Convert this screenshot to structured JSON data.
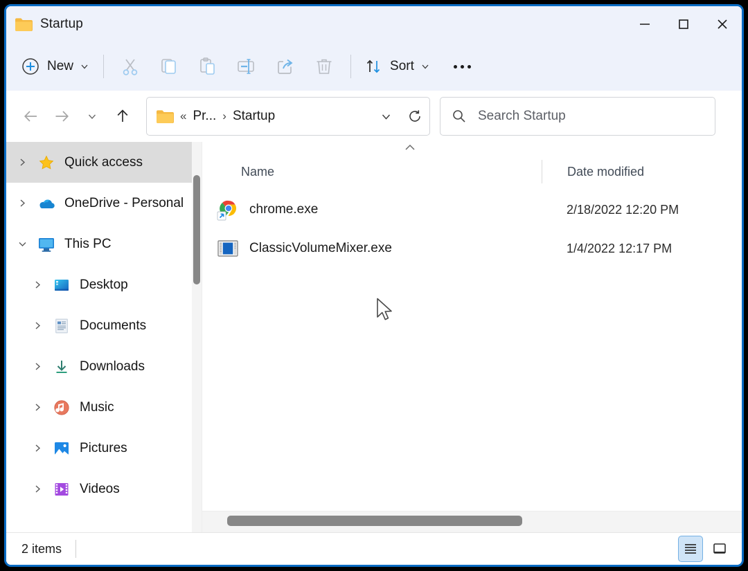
{
  "window": {
    "title": "Startup",
    "title_icon": "folder-icon",
    "controls": {
      "minimize": "minimize-icon",
      "maximize": "maximize-icon",
      "close": "close-icon"
    }
  },
  "toolbar": {
    "new_label": "New",
    "new_icon": "plus-circle-icon",
    "new_chevron": "chevron-down-icon",
    "actions": [
      {
        "name": "cut",
        "icon": "scissors-icon",
        "enabled": false
      },
      {
        "name": "copy",
        "icon": "copy-icon",
        "enabled": false
      },
      {
        "name": "paste",
        "icon": "clipboard-paste-icon",
        "enabled": false
      },
      {
        "name": "rename",
        "icon": "rename-icon",
        "enabled": false
      },
      {
        "name": "share",
        "icon": "share-icon",
        "enabled": false
      },
      {
        "name": "delete",
        "icon": "trash-icon",
        "enabled": false
      }
    ],
    "sort_label": "Sort",
    "sort_icon": "sort-arrows-icon",
    "more_label": "See more",
    "more_icon": "ellipsis-icon"
  },
  "navigation": {
    "back_icon": "arrow-left-icon",
    "forward_icon": "arrow-right-icon",
    "recent_icon": "chevron-down-icon",
    "up_icon": "arrow-up-icon"
  },
  "addressbar": {
    "folder_icon": "folder-icon",
    "overflow": "«",
    "crumbs": [
      {
        "label": "Pr...",
        "separator": "›"
      },
      {
        "label": "Startup",
        "separator": ""
      }
    ],
    "dropdown_icon": "chevron-down-icon",
    "refresh_icon": "refresh-icon"
  },
  "search": {
    "icon": "search-icon",
    "placeholder": "Search Startup",
    "value": ""
  },
  "sidebar": {
    "items": [
      {
        "label": "Quick access",
        "icon": "star-icon",
        "chevron": "chevron-right-icon",
        "selected": true,
        "indent": false
      },
      {
        "label": "OneDrive - Personal",
        "icon": "cloud-icon",
        "chevron": "chevron-right-icon",
        "selected": false,
        "indent": false
      },
      {
        "label": "This PC",
        "icon": "monitor-icon",
        "chevron": "chevron-down-icon",
        "selected": false,
        "indent": false
      },
      {
        "label": "Desktop",
        "icon": "desktop-icon",
        "chevron": "chevron-right-icon",
        "selected": false,
        "indent": true
      },
      {
        "label": "Documents",
        "icon": "documents-icon",
        "chevron": "chevron-right-icon",
        "selected": false,
        "indent": true
      },
      {
        "label": "Downloads",
        "icon": "downloads-icon",
        "chevron": "chevron-right-icon",
        "selected": false,
        "indent": true
      },
      {
        "label": "Music",
        "icon": "music-icon",
        "chevron": "chevron-right-icon",
        "selected": false,
        "indent": true
      },
      {
        "label": "Pictures",
        "icon": "pictures-icon",
        "chevron": "chevron-right-icon",
        "selected": false,
        "indent": true
      },
      {
        "label": "Videos",
        "icon": "videos-icon",
        "chevron": "chevron-right-icon",
        "selected": false,
        "indent": true
      }
    ]
  },
  "filelist": {
    "sort_indicator": "chevron-up-icon",
    "columns": [
      {
        "key": "name",
        "label": "Name"
      },
      {
        "key": "date",
        "label": "Date modified"
      }
    ],
    "rows": [
      {
        "name": "chrome.exe",
        "icon": "chrome-shortcut-icon",
        "date": "2/18/2022 12:20 PM"
      },
      {
        "name": "ClassicVolumeMixer.exe",
        "icon": "app-window-icon",
        "date": "1/4/2022 12:17 PM"
      }
    ]
  },
  "statusbar": {
    "item_count": "2 items",
    "views": [
      {
        "name": "details-view",
        "icon": "details-view-icon",
        "active": true
      },
      {
        "name": "preview-pane",
        "icon": "preview-pane-icon",
        "active": false
      }
    ]
  },
  "colors": {
    "accent": "#0a6cc4",
    "chrome_bg": "#eef2fb",
    "selection": "#dcdcdc",
    "disabled_icon": "#b4b8bf",
    "blue_accent": "#3b9ae1"
  }
}
